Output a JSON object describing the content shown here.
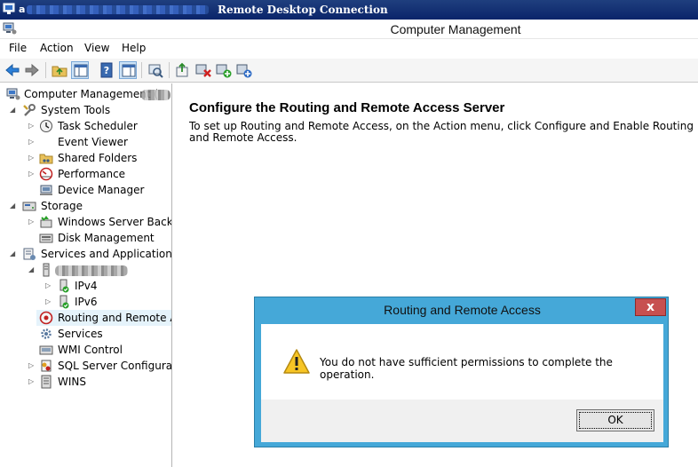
{
  "rdp": {
    "user_prefix": "a",
    "title": "Remote Desktop Connection"
  },
  "window": {
    "title": "Computer Management"
  },
  "menu": [
    "File",
    "Action",
    "View",
    "Help"
  ],
  "toolbar": {
    "icons": [
      "back-arrow-icon",
      "forward-arrow-icon",
      "up-folder-icon",
      "show-hide-tree-icon",
      "help-icon",
      "show-hide-action-pane-icon",
      "properties-icon",
      "export-icon",
      "delete-red-x-icon",
      "add-green-icon",
      "refresh-blue-icon"
    ]
  },
  "tree": {
    "root": "Computer Management (",
    "system_tools": "System Tools",
    "task_scheduler": "Task Scheduler",
    "event_viewer": "Event Viewer",
    "shared_folders": "Shared Folders",
    "performance": "Performance",
    "device_manager": "Device Manager",
    "storage": "Storage",
    "windows_server_backup": "Windows Server Backup",
    "disk_management": "Disk Management",
    "services_and_applications": "Services and Applications",
    "ipv4": "IPv4",
    "ipv6": "IPv6",
    "routing": "Routing and Remote Ac",
    "services": "Services",
    "wmi_control": "WMI Control",
    "sql_server": "SQL Server Configuratic",
    "wins": "WINS"
  },
  "content": {
    "heading": "Configure the Routing and Remote Access Server",
    "text": "To set up Routing and Remote Access, on the Action menu, click Configure and Enable Routing and Remote Access."
  },
  "dialog": {
    "title": "Routing and Remote Access",
    "close": "x",
    "message": "You do not have sufficient permissions to complete the operation.",
    "ok": "OK"
  }
}
